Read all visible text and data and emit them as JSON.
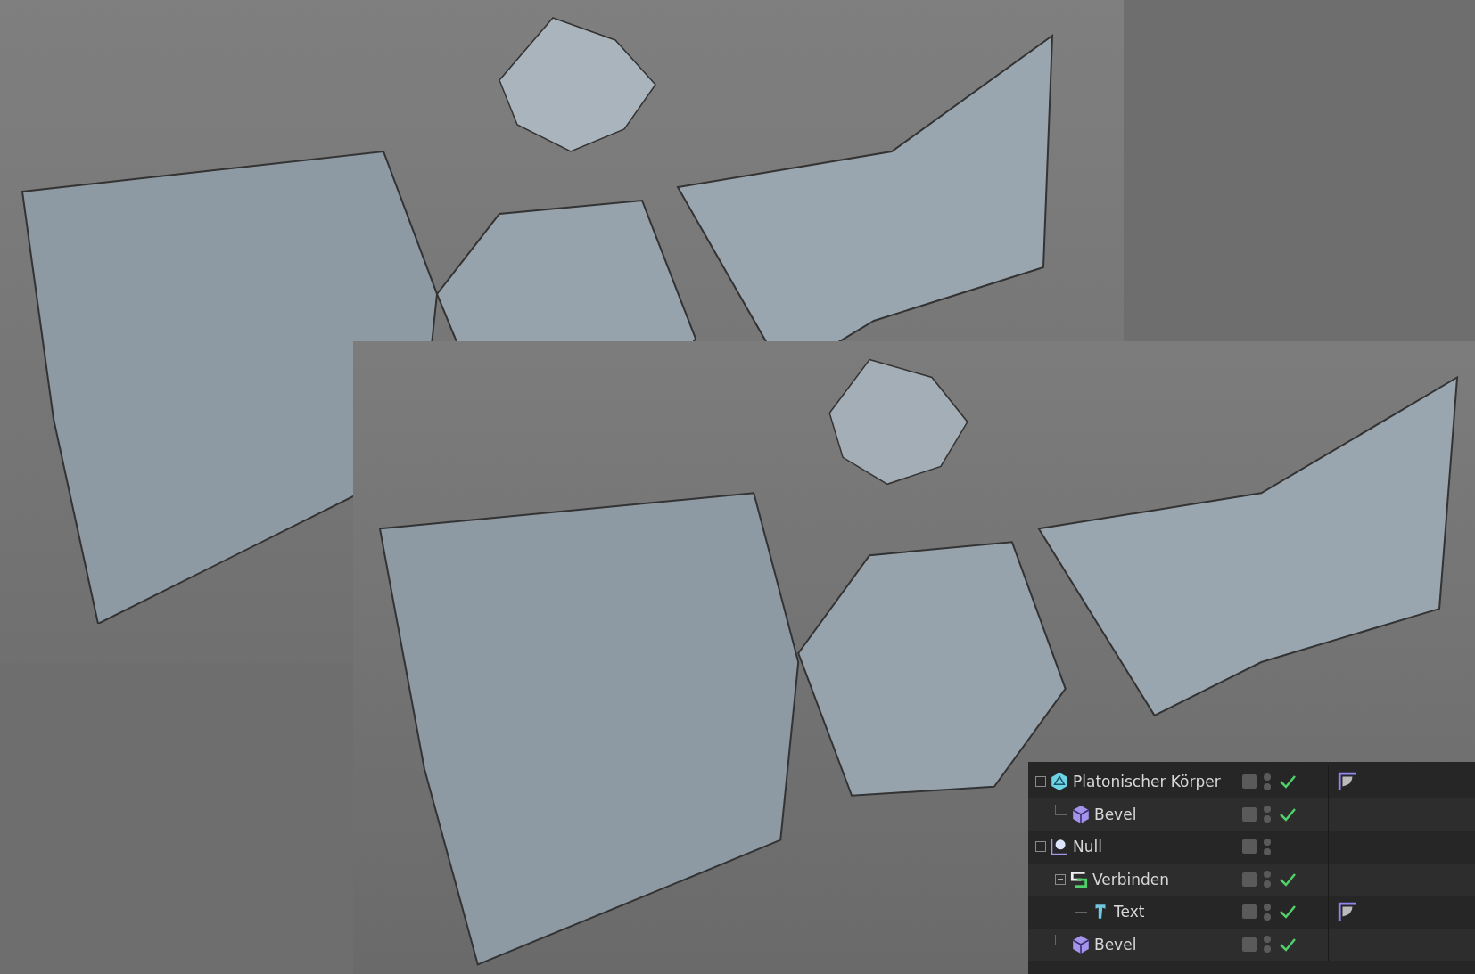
{
  "object_manager": {
    "objects": [
      {
        "name": "Platonischer Körper",
        "kind": "platonic",
        "expanded": true,
        "enabled": true,
        "tag": true,
        "children": [
          {
            "name": "Bevel",
            "kind": "bevel",
            "enabled": true,
            "tag": false
          }
        ]
      },
      {
        "name": "Null",
        "kind": "null",
        "expanded": true,
        "enabled": false,
        "tag": false,
        "children": [
          {
            "name": "Verbinden",
            "kind": "connect",
            "expanded": true,
            "enabled": true,
            "tag": false,
            "children": [
              {
                "name": "Text",
                "kind": "text",
                "enabled": true,
                "tag": true
              }
            ]
          },
          {
            "name": "Bevel",
            "kind": "bevel",
            "enabled": true,
            "tag": false
          }
        ]
      }
    ]
  }
}
